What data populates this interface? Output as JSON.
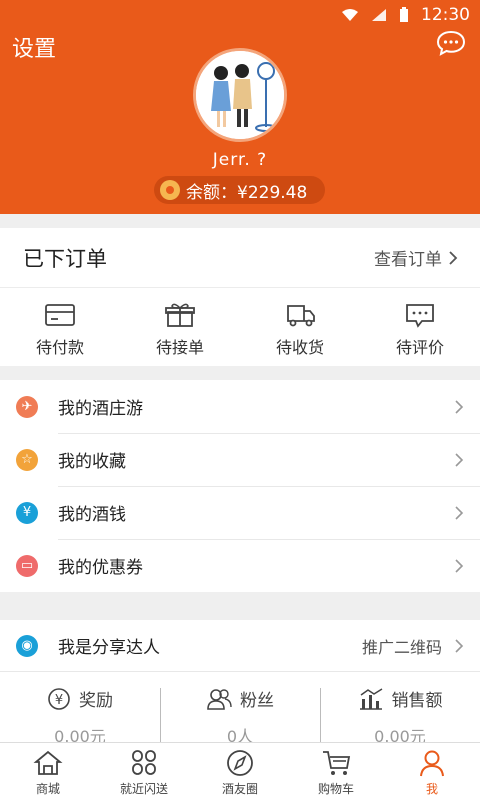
{
  "status_bar": {
    "time": "12:30"
  },
  "header": {
    "title": "设置",
    "username": "Jerr.   ?",
    "balance_label": "余额：¥229.48"
  },
  "orders": {
    "title": "已下订单",
    "view_all": "查看订单",
    "items": [
      {
        "label": "待付款",
        "icon": "card-icon"
      },
      {
        "label": "待接单",
        "icon": "gift-icon"
      },
      {
        "label": "待收货",
        "icon": "truck-icon"
      },
      {
        "label": "待评价",
        "icon": "comment-icon"
      }
    ]
  },
  "menu": [
    {
      "label": "我的酒庄游",
      "icon": "tour-icon",
      "color": "#f07c55"
    },
    {
      "label": "我的收藏",
      "icon": "star-icon",
      "color": "#f2a33a"
    },
    {
      "label": "我的酒钱",
      "icon": "yen-icon",
      "color": "#1aa0d8"
    },
    {
      "label": "我的优惠券",
      "icon": "coupon-icon",
      "color": "#ef6b6b"
    }
  ],
  "share": {
    "title": "我是分享达人",
    "promo": "推广二维码",
    "stats": [
      {
        "label": "奖励",
        "value": "0.00元",
        "icon": "yen-circle-icon"
      },
      {
        "label": "粉丝",
        "value": "0人",
        "icon": "people-icon"
      },
      {
        "label": "销售额",
        "value": "0.00元",
        "icon": "bar-chart-icon"
      }
    ]
  },
  "bottom_nav": [
    {
      "label": "商城",
      "icon": "home-icon",
      "active": false
    },
    {
      "label": "就近闪送",
      "icon": "grid-icon",
      "active": false
    },
    {
      "label": "酒友圈",
      "icon": "compass-icon",
      "active": false
    },
    {
      "label": "购物车",
      "icon": "cart-icon",
      "active": false
    },
    {
      "label": "我",
      "icon": "person-icon",
      "active": true
    }
  ],
  "colors": {
    "brand": "#e95a1a"
  }
}
